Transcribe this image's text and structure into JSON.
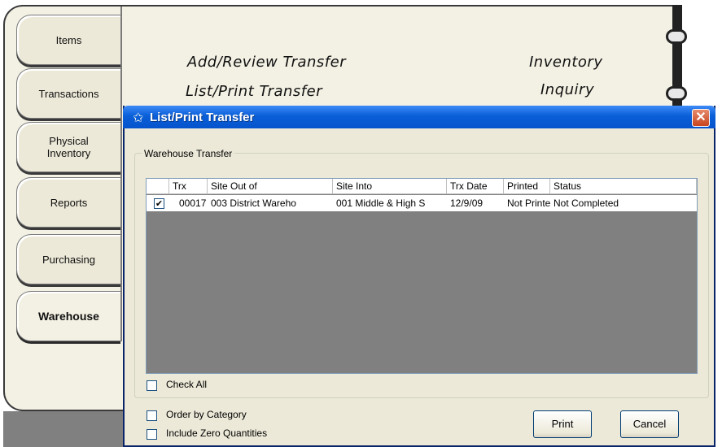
{
  "tabs": [
    {
      "label": "Items"
    },
    {
      "label": "Transactions"
    },
    {
      "label": "Physical Inventory"
    },
    {
      "label": "Reports"
    },
    {
      "label": "Purchasing"
    },
    {
      "label": "Warehouse",
      "active": true
    }
  ],
  "header_links": {
    "add_review": "Add/Review Transfer",
    "list_print": "List/Print Transfer",
    "inventory": "Inventory",
    "inquiry": "Inquiry"
  },
  "dialog": {
    "title": "List/Print Transfer",
    "close_label": "✕",
    "group_label": "Warehouse Transfer",
    "columns": [
      "",
      "Trx",
      "Site Out of",
      "Site Into",
      "Trx Date",
      "Printed",
      "Status"
    ],
    "rows": [
      {
        "checked": true,
        "trx": "00017",
        "site_out": "003 District Wareho",
        "site_into": "001 Middle & High S",
        "trx_date": "12/9/09",
        "printed": "Not Printe",
        "status": "Not Completed"
      }
    ],
    "check_all_label": "Check All",
    "order_by_category_label": "Order by Category",
    "include_zero_label": "Include Zero Quantities",
    "print_label": "Print",
    "cancel_label": "Cancel"
  },
  "colors": {
    "titlebar": "#0553cc",
    "grid_background": "#808080",
    "close_button": "#c8451f"
  }
}
